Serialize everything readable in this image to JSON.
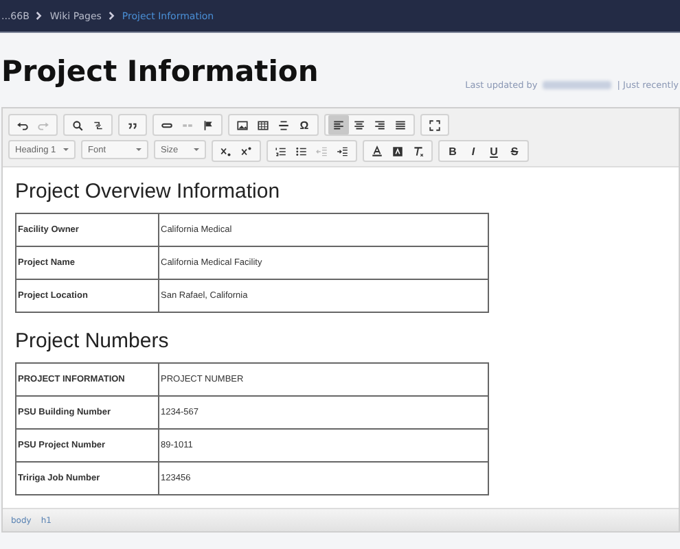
{
  "breadcrumb": [
    {
      "label": "...66B",
      "selected": false
    },
    {
      "label": "Wiki Pages",
      "selected": false
    },
    {
      "label": "Project Information",
      "selected": true
    }
  ],
  "page_title": "Project Information",
  "last_updated": {
    "prefix": "Last updated by",
    "suffix": "| Just recently"
  },
  "toolbar_rows": [
    {
      "groups": [
        [
          {
            "kind": "undo",
            "disabled": false
          },
          {
            "kind": "redo",
            "disabled": true
          }
        ],
        [
          {
            "kind": "search",
            "disabled": false
          },
          {
            "kind": "replace",
            "disabled": false
          }
        ],
        [
          {
            "kind": "quote",
            "disabled": false
          }
        ],
        [
          {
            "kind": "link",
            "disabled": false
          },
          {
            "kind": "unlink",
            "disabled": true
          },
          {
            "kind": "flag",
            "disabled": false
          }
        ],
        [
          {
            "kind": "image",
            "disabled": false
          },
          {
            "kind": "table",
            "disabled": false
          },
          {
            "kind": "rule",
            "disabled": false
          },
          {
            "kind": "char",
            "label": "Ω",
            "disabled": false
          }
        ],
        [
          {
            "kind": "align-left",
            "disabled": false,
            "selected": true
          },
          {
            "kind": "align-center",
            "disabled": false,
            "selected": false
          },
          {
            "kind": "align-right",
            "disabled": false,
            "selected": false
          },
          {
            "kind": "justify",
            "disabled": false,
            "selected": false
          }
        ],
        [
          {
            "kind": "fullscreen",
            "disabled": false
          }
        ]
      ]
    },
    {
      "dropdowns": [
        {
          "label": "Heading 1"
        },
        {
          "label": "Font"
        },
        {
          "label": "Size"
        }
      ],
      "groups": [
        [
          {
            "kind": "subscript",
            "disabled": false
          },
          {
            "kind": "superscript",
            "disabled": false
          }
        ],
        [
          {
            "kind": "numbered-list",
            "disabled": false
          },
          {
            "kind": "bullet-list",
            "disabled": false
          },
          {
            "kind": "outdent",
            "disabled": true
          },
          {
            "kind": "indent",
            "disabled": false
          }
        ],
        [
          {
            "kind": "text-color",
            "disabled": false
          },
          {
            "kind": "background-color",
            "disabled": false
          },
          {
            "kind": "clear-format",
            "disabled": false
          }
        ],
        [
          {
            "kind": "bold",
            "label": "B",
            "disabled": false
          },
          {
            "kind": "italic",
            "label": "I",
            "disabled": false
          },
          {
            "kind": "underline",
            "label": "U",
            "disabled": false
          },
          {
            "kind": "strike",
            "label": "S",
            "disabled": false
          }
        ]
      ]
    }
  ],
  "sections": [
    {
      "heading": "Project Overview Information",
      "rows": [
        [
          "Facility Owner",
          "California Medical"
        ],
        [
          "Project Name",
          "California Medical Facility"
        ],
        [
          "Project Location",
          "San Rafael, California"
        ]
      ]
    },
    {
      "heading": "Project Numbers",
      "rows": [
        [
          "PROJECT INFORMATION",
          "PROJECT NUMBER"
        ],
        [
          "PSU Building Number",
          "1234-567"
        ],
        [
          "PSU Project Number",
          "89-1011"
        ],
        [
          "Tririga Job Number",
          "123456"
        ]
      ]
    }
  ],
  "status_path": [
    "body",
    "h1"
  ]
}
